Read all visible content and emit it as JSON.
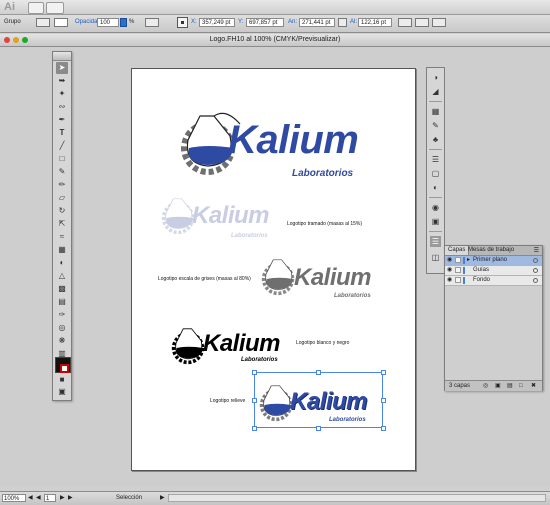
{
  "app": {
    "logo": "Ai"
  },
  "control_bar": {
    "selection_label": "Grupo",
    "opacity_label": "Opacidad:",
    "opacity_value": "100",
    "percent": "%",
    "x_label": "X:",
    "x_value": "357,249 pt",
    "y_label": "Y:",
    "y_value": "697,857 pt",
    "w_label": "An:",
    "w_value": "271,441 pt",
    "h_label": "Al:",
    "h_value": "122,16 pt"
  },
  "document": {
    "title": "Logo.FH10 al 100% (CMYK/Previsualizar)"
  },
  "artwork": {
    "brand": "Kalium",
    "sub": "Laboratorios",
    "captions": {
      "tramado": "Logotipo tramado (masas al 15%)",
      "grises": "Logotipo escala de grises (masas al 80%)",
      "bn": "Logotipo blanco y negro",
      "relieve": "Logotipo relieve"
    },
    "colors": {
      "brand_blue": "#2f4aa3",
      "light": "#c9cde3",
      "gray": "#6f6f6f",
      "black": "#000000"
    }
  },
  "layers_panel": {
    "tabs": [
      "Capas",
      "Mesas de trabajo"
    ],
    "layers": [
      {
        "name": "Primer plano",
        "selected": true
      },
      {
        "name": "Guías",
        "selected": false
      },
      {
        "name": "Fondo",
        "selected": false
      }
    ],
    "footer": "3 capas"
  },
  "status_bar": {
    "zoom": "100%",
    "page": "1",
    "mode": "Selección"
  }
}
